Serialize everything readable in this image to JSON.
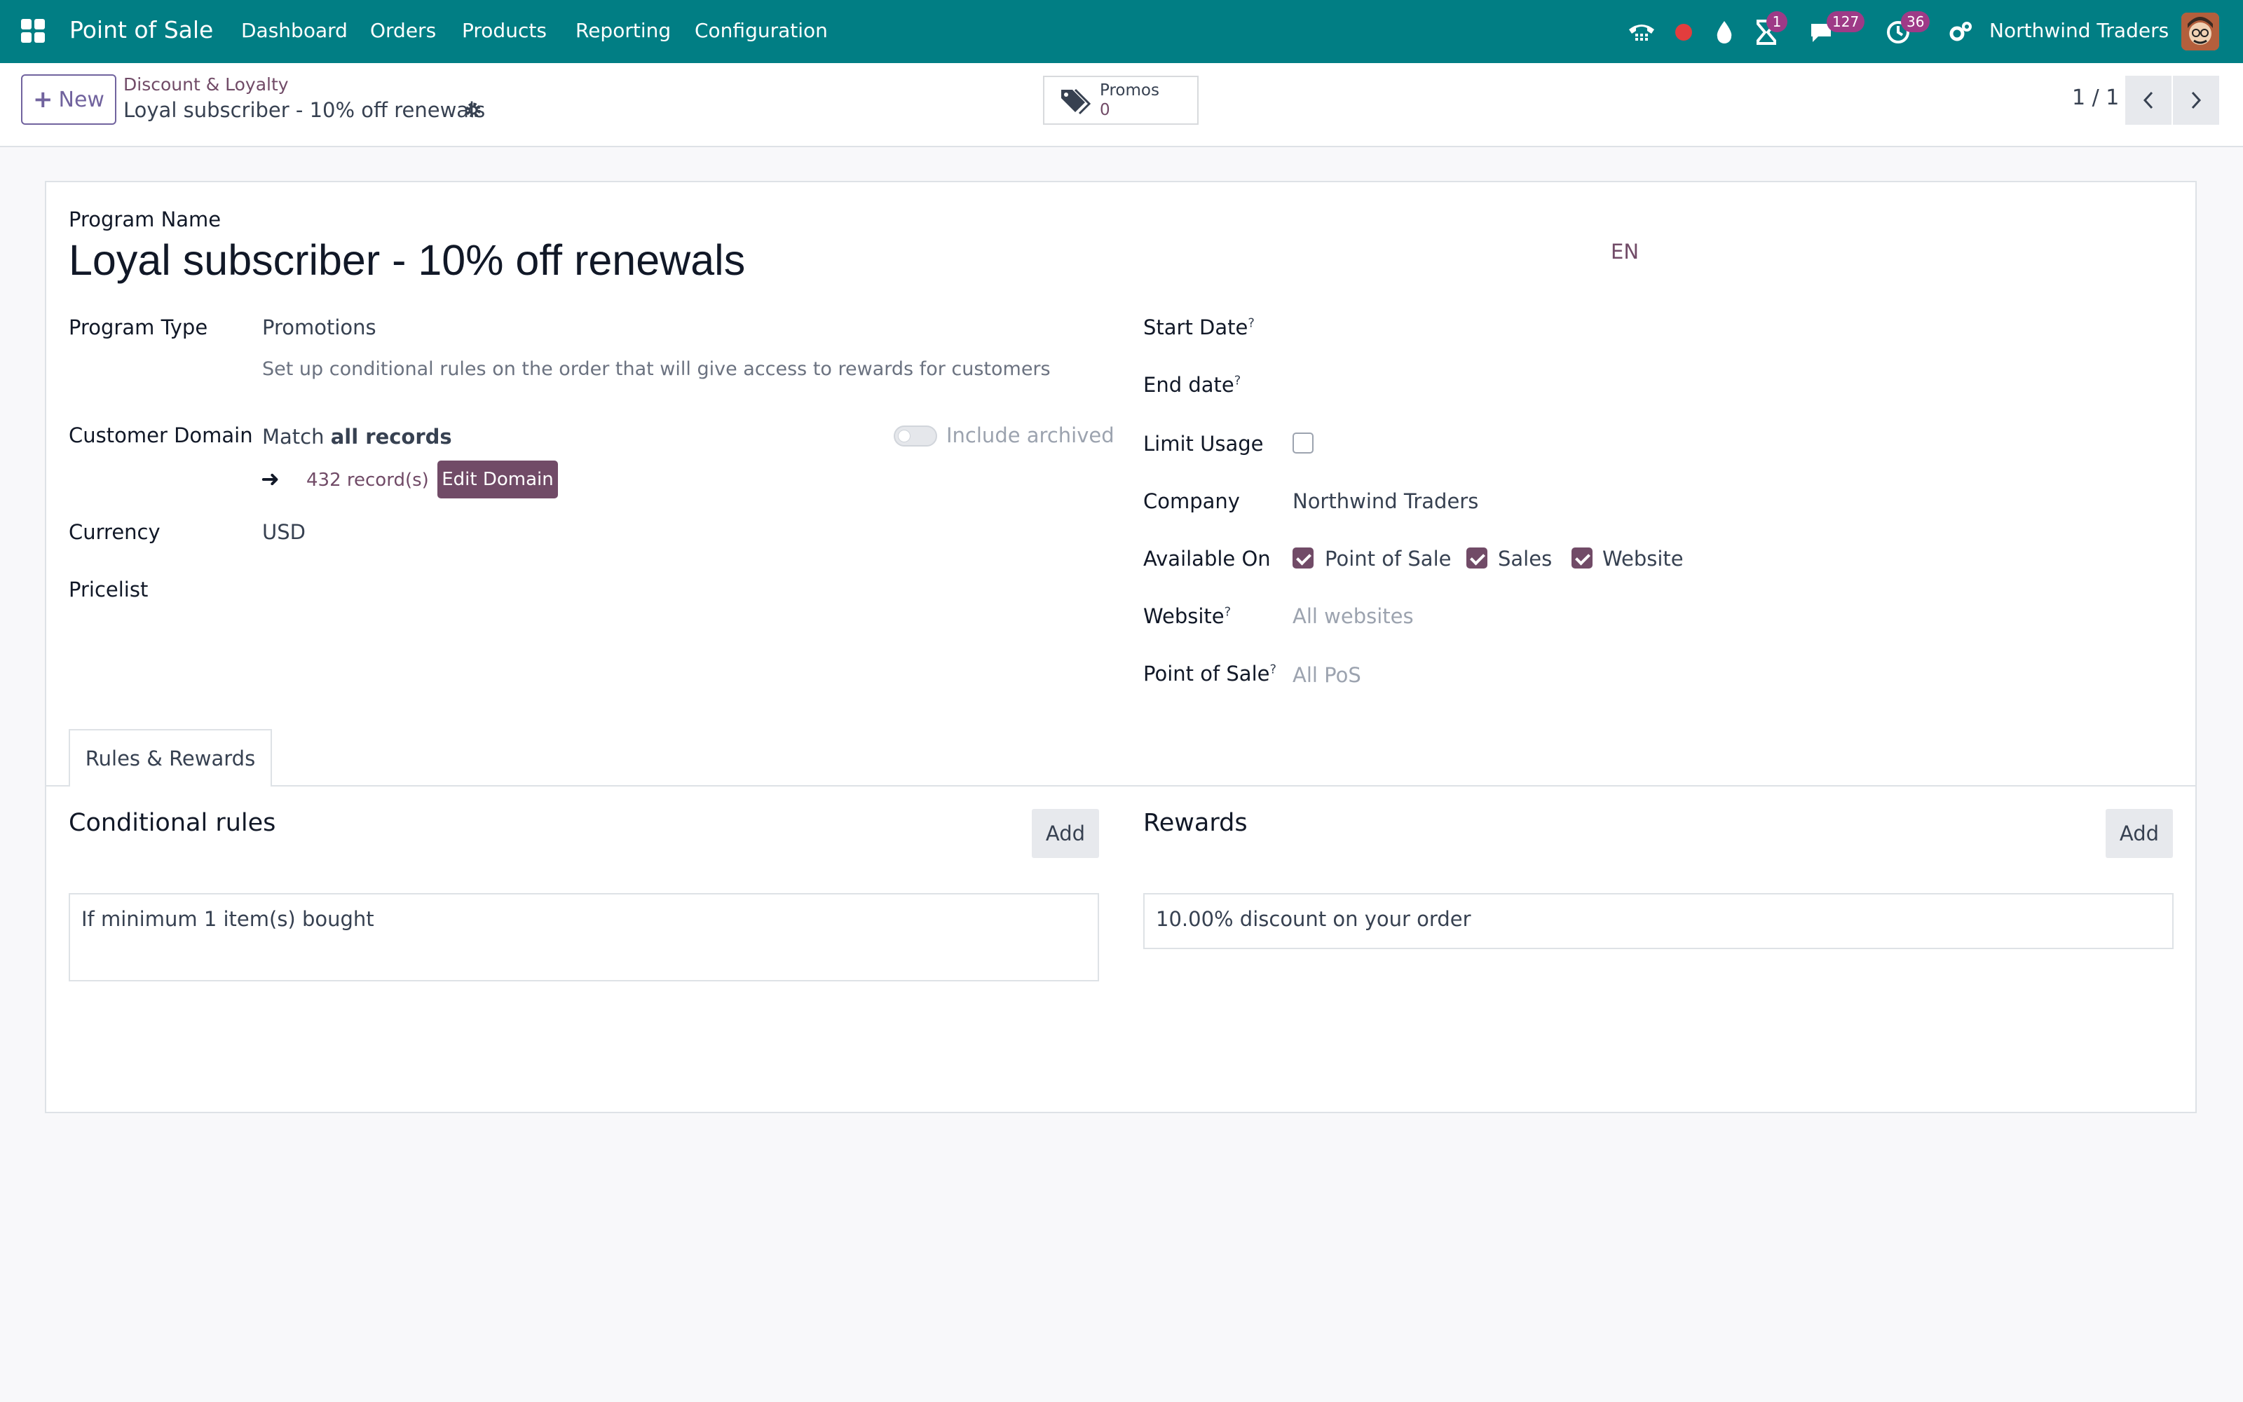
{
  "navbar": {
    "app_name": "Point of Sale",
    "menu": [
      "Dashboard",
      "Orders",
      "Products",
      "Reporting",
      "Configuration"
    ],
    "badges": {
      "activities": "1",
      "messages": "127",
      "clock": "36"
    },
    "company": "Northwind Traders",
    "icons": [
      "apps-grid-icon",
      "phone-icon",
      "status-dot-icon",
      "drop-icon",
      "hourglass-icon",
      "chat-icon",
      "clock-icon",
      "settings-icon"
    ],
    "color": "#017e84"
  },
  "control_panel": {
    "new_label": "New",
    "breadcrumb_parent": "Discount & Loyalty",
    "breadcrumb_current": "Loyal subscriber - 10% off renewals",
    "smart_button": {
      "label": "Promos",
      "value": "0"
    },
    "pager": "1 / 1"
  },
  "form": {
    "program_name_label": "Program Name",
    "program_name": "Loyal subscriber - 10% off renewals",
    "lang": "EN",
    "program_type_label": "Program Type",
    "program_type": "Promotions",
    "program_type_help": "Set up conditional rules on the order that will give access to rewards for customers",
    "customer_domain_label": "Customer Domain",
    "match_prefix": "Match",
    "match_bold": "all records",
    "include_archived": "Include archived",
    "include_archived_checked": false,
    "records_link": "432 record(s)",
    "edit_domain": "Edit Domain",
    "currency_label": "Currency",
    "currency": "USD",
    "pricelist_label": "Pricelist",
    "start_date_label": "Start Date",
    "end_date_label": "End date",
    "limit_usage_label": "Limit Usage",
    "limit_usage_checked": false,
    "company_label": "Company",
    "company": "Northwind Traders",
    "available_on_label": "Available On",
    "available_on": [
      {
        "label": "Point of Sale",
        "checked": true
      },
      {
        "label": "Sales",
        "checked": true
      },
      {
        "label": "Website",
        "checked": true
      }
    ],
    "website_label": "Website",
    "website_placeholder": "All websites",
    "pos_label": "Point of Sale",
    "pos_placeholder": "All PoS",
    "help_mark": "?",
    "accent_color": "#714b67"
  },
  "tabs": {
    "active": "Rules & Rewards",
    "conditional_rules_title": "Conditional rules",
    "rewards_title": "Rewards",
    "add_label": "Add",
    "rules": [
      "If minimum 1 item(s) bought"
    ],
    "rewards": [
      "10.00% discount on your order"
    ]
  }
}
